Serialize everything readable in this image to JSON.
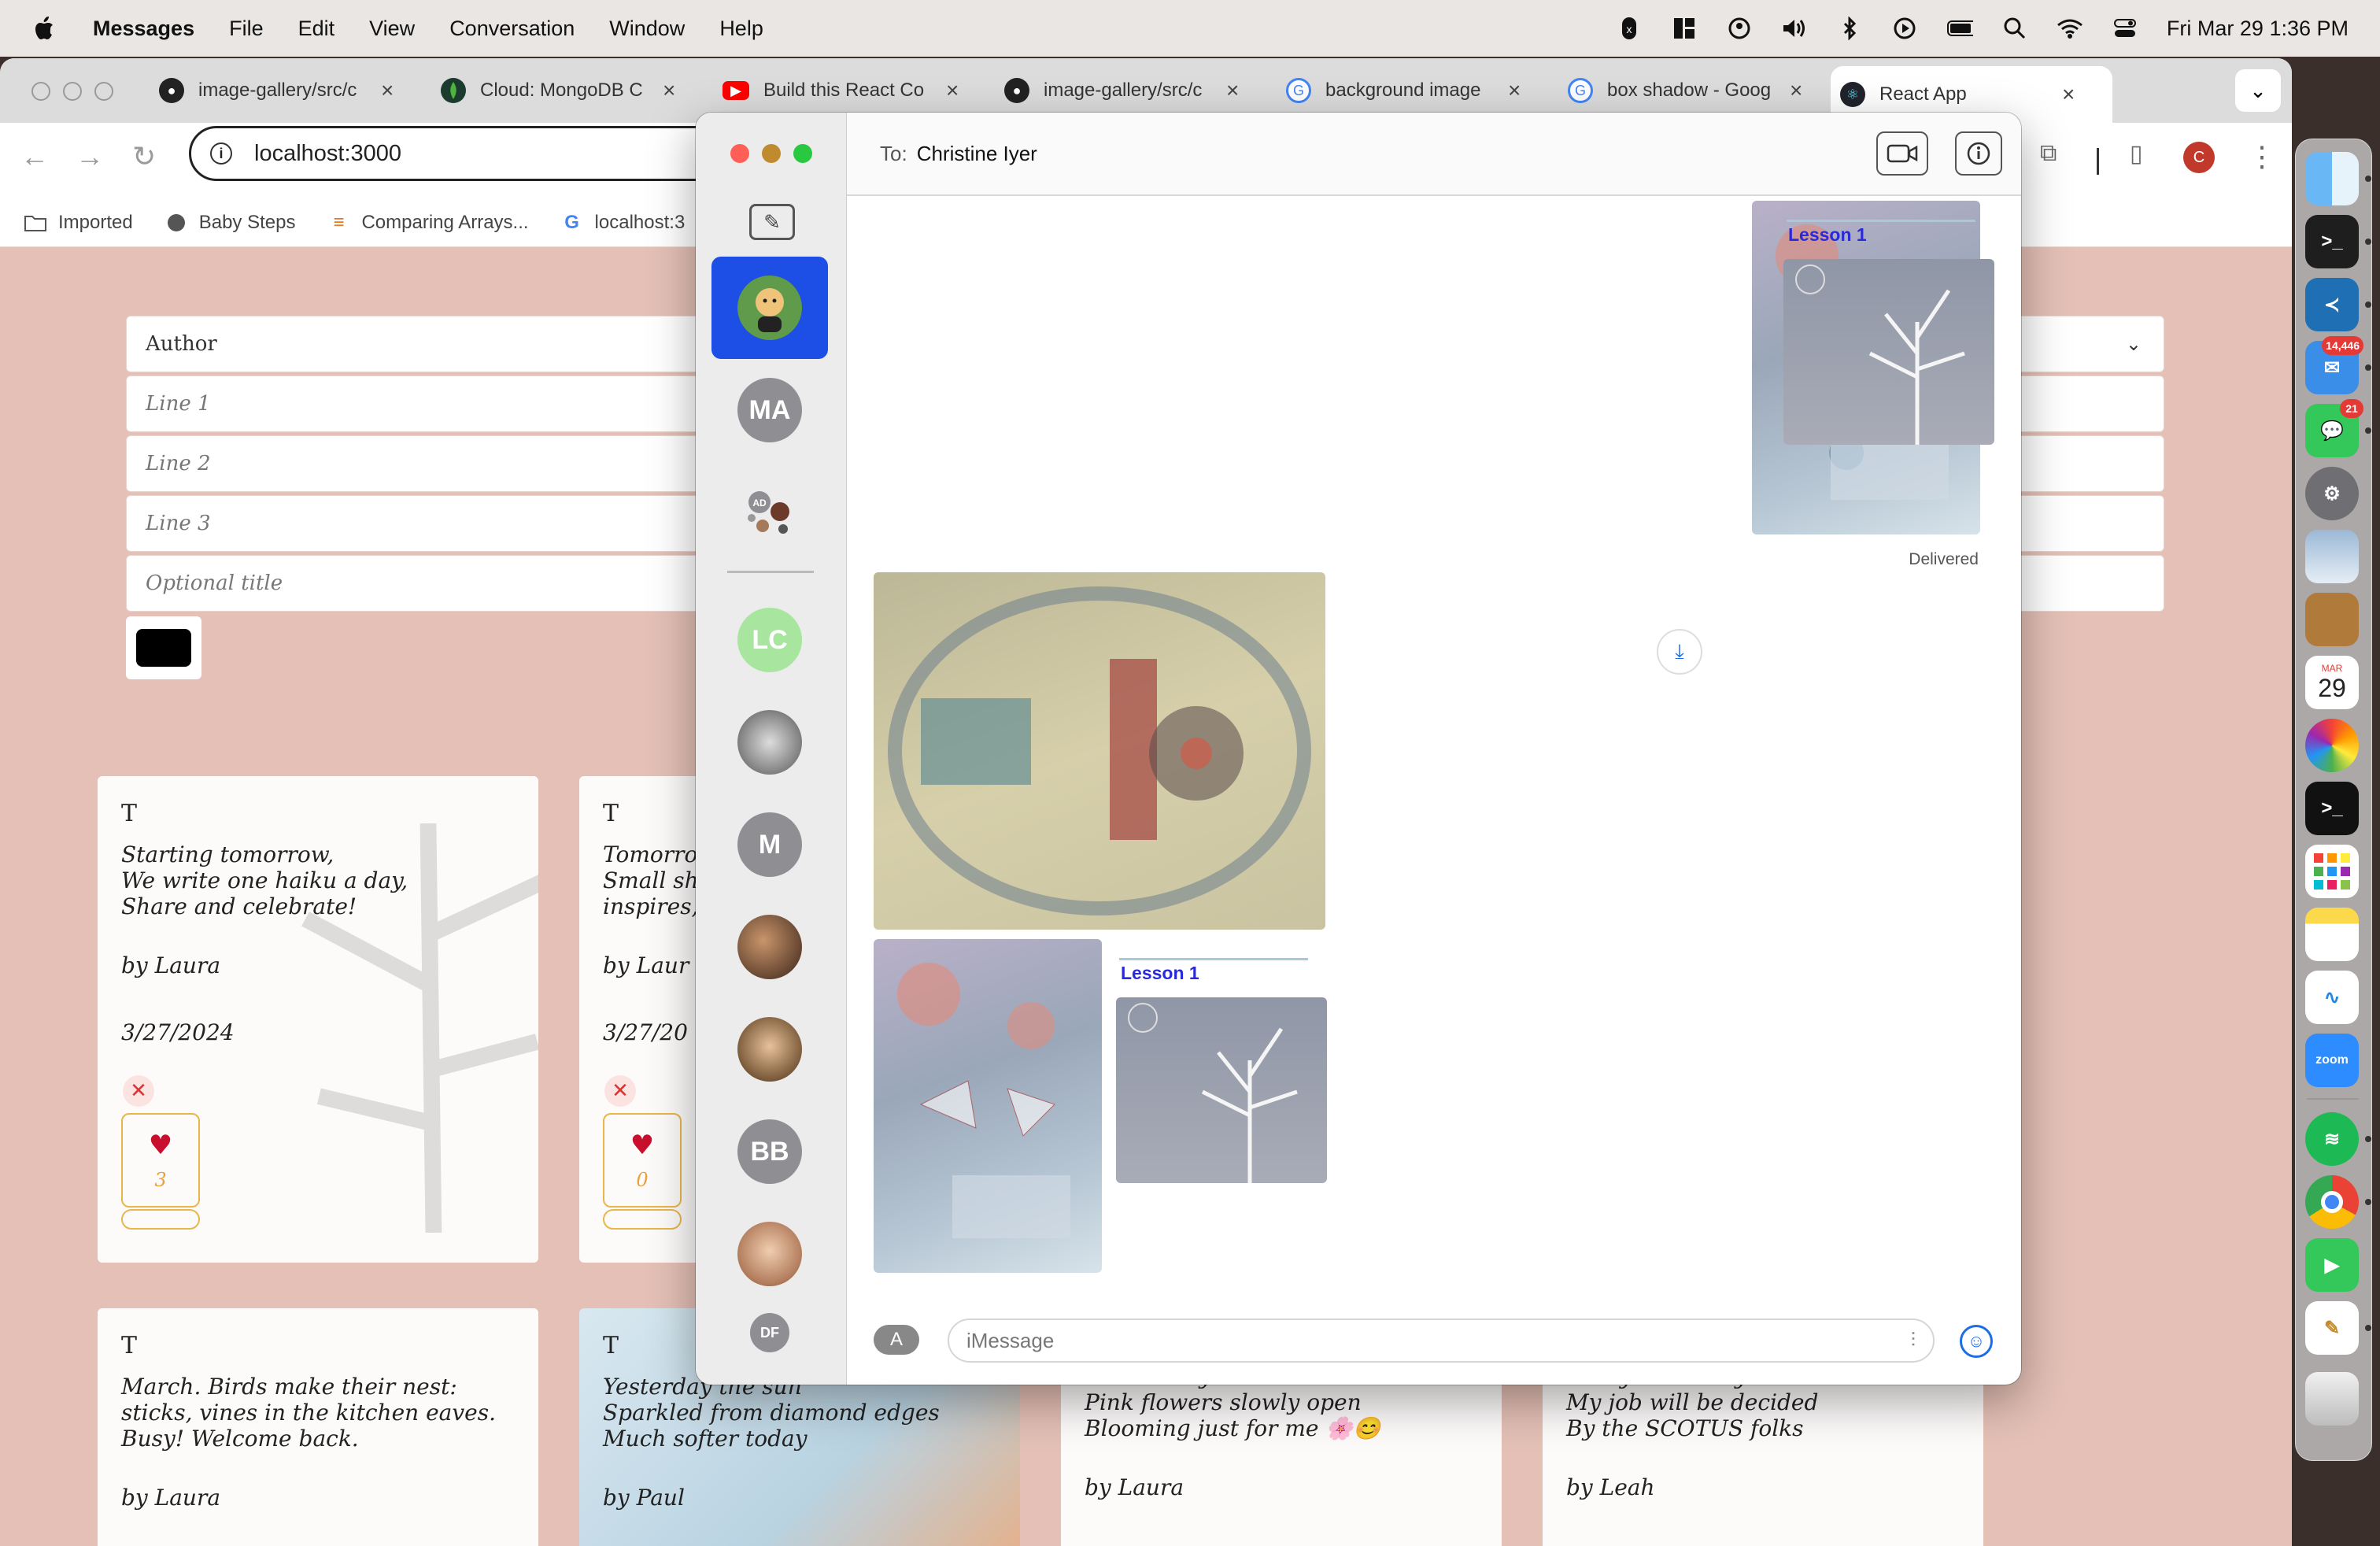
{
  "menubar": {
    "app": "Messages",
    "items": [
      "File",
      "Edit",
      "View",
      "Conversation",
      "Window",
      "Help"
    ],
    "datetime": "Fri Mar 29  1:36 PM"
  },
  "browser": {
    "tabs": [
      {
        "title": "image-gallery/src/c",
        "icon": "github-icon"
      },
      {
        "title": "Cloud: MongoDB C",
        "icon": "mongodb-icon"
      },
      {
        "title": "Build this React Co",
        "icon": "youtube-icon"
      },
      {
        "title": "image-gallery/src/c",
        "icon": "github-icon"
      },
      {
        "title": "background image",
        "icon": "google-icon"
      },
      {
        "title": "box shadow - Goog",
        "icon": "google-icon"
      },
      {
        "title": "React App",
        "icon": "react-icon"
      }
    ],
    "url": "localhost:3000",
    "profile_initial": "C",
    "bookmarks": [
      "Imported",
      "Baby Steps",
      "Comparing Arrays...",
      "localhost:3"
    ]
  },
  "page": {
    "form": {
      "author_placeholder": "Author",
      "line1_placeholder": "Line 1",
      "line2_placeholder": "Line 2",
      "line3_placeholder": "Line 3",
      "title_placeholder": "Optional title"
    },
    "cards": [
      {
        "title": "T",
        "poem": "Starting tomorrow,\nWe write one haiku a day,\nShare and celebrate!",
        "by": "by Laura",
        "date": "3/27/2024",
        "likes": "3",
        "delete": "✕",
        "heart": "♥"
      },
      {
        "title": "T",
        "poem": "Tomorrow\nSmall sh\ninspires,",
        "by": "by Laur",
        "date": "3/27/20",
        "likes": "0",
        "delete": "✕",
        "heart": "♥"
      },
      {
        "title": "T",
        "poem": "March. Birds make their nest:\nsticks, vines in the kitchen eaves.\nBusy! Welcome back.",
        "by": "by Laura"
      },
      {
        "title": "T",
        "poem": "Yesterday the sun\nSparkled from diamond edges\nMuch softer today",
        "by": "by Paul"
      },
      {
        "poem": "Outside my window\nPink flowers slowly open\nBlooming just for me 🌸😊",
        "by": "by Laura"
      },
      {
        "poem": "Today is the day\nMy job will be decided\nBy the SCOTUS folks",
        "by": "by Leah"
      }
    ]
  },
  "messages": {
    "to_label": "To:",
    "recipient": "Christine Iyer",
    "conversations": [
      {
        "initials": "",
        "color": "#1d4ee6"
      },
      {
        "initials": "MA",
        "color": "#8e8e93"
      },
      {
        "initials": "AD",
        "color": "#8e8e93"
      },
      {
        "initials": "LC",
        "color": "#a8e6a0"
      },
      {
        "initials": "",
        "color": "#777"
      },
      {
        "initials": "M",
        "color": "#8e8e93"
      },
      {
        "initials": "",
        "color": "#6b4a3a"
      },
      {
        "initials": "",
        "color": "#a07a5a"
      },
      {
        "initials": "BB",
        "color": "#8e8e93"
      },
      {
        "initials": "",
        "color": "#c9a48a"
      },
      {
        "initials": "DF",
        "color": "#8e8e93"
      }
    ],
    "lesson_label": "Lesson 1",
    "status": "Delivered",
    "input_placeholder": "iMessage"
  },
  "dock": {
    "mail_badge": "14,446",
    "messages_badge": "21",
    "calendar_month": "MAR",
    "calendar_day": "29",
    "zoom_label": "zoom"
  }
}
